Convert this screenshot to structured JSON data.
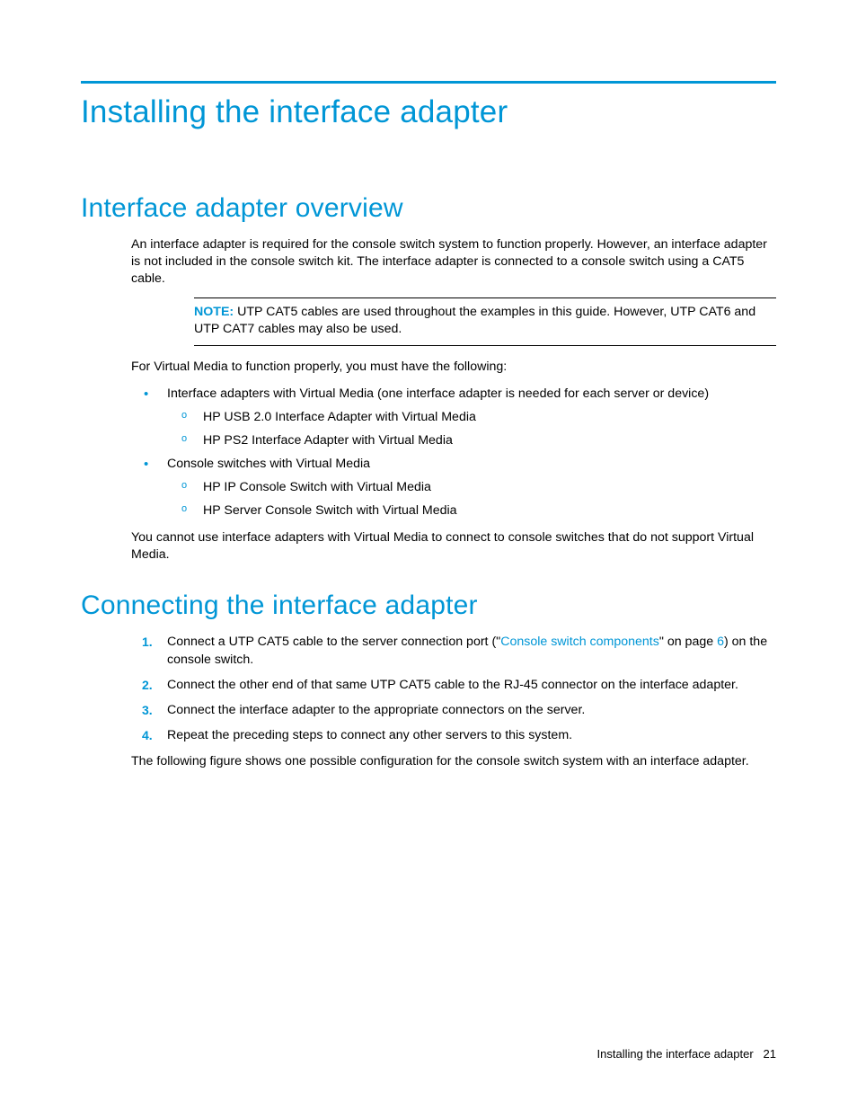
{
  "title": "Installing the interface adapter",
  "sections": {
    "overview": {
      "heading": "Interface adapter overview",
      "intro": "An interface adapter is required for the console switch system to function properly. However, an interface adapter is not included in the console switch kit. The interface adapter is connected to a console switch using a CAT5 cable.",
      "note_label": "NOTE:",
      "note_body": "UTP CAT5 cables are used throughout the examples in this guide. However, UTP CAT6 and UTP CAT7 cables may also be used.",
      "vm_intro": "For Virtual Media to function properly, you must have the following:",
      "bullets": [
        {
          "text": "Interface adapters with Virtual Media (one interface adapter is needed for each server or device)",
          "sub": [
            "HP USB 2.0 Interface Adapter with Virtual Media",
            "HP PS2 Interface Adapter with Virtual Media"
          ]
        },
        {
          "text": "Console switches with Virtual Media",
          "sub": [
            "HP IP Console Switch with Virtual Media",
            "HP Server Console Switch with Virtual Media"
          ]
        }
      ],
      "vm_outro": "You cannot use interface adapters with Virtual Media to connect to console switches that do not support Virtual Media."
    },
    "connecting": {
      "heading": "Connecting the interface adapter",
      "steps": {
        "s1_a": "Connect a UTP CAT5 cable to the server connection port (\"",
        "s1_link": "Console switch components",
        "s1_b": "\" on page ",
        "s1_page": "6",
        "s1_c": ") on the console switch.",
        "s2": "Connect the other end of that same UTP CAT5 cable to the RJ-45 connector on the interface adapter.",
        "s3": "Connect the interface adapter to the appropriate connectors on the server.",
        "s4": "Repeat the preceding steps to connect any other servers to this system."
      },
      "figure_intro": "The following figure shows one possible configuration for the console switch system with an interface adapter."
    }
  },
  "footer": {
    "title": "Installing the interface adapter",
    "page": "21"
  }
}
